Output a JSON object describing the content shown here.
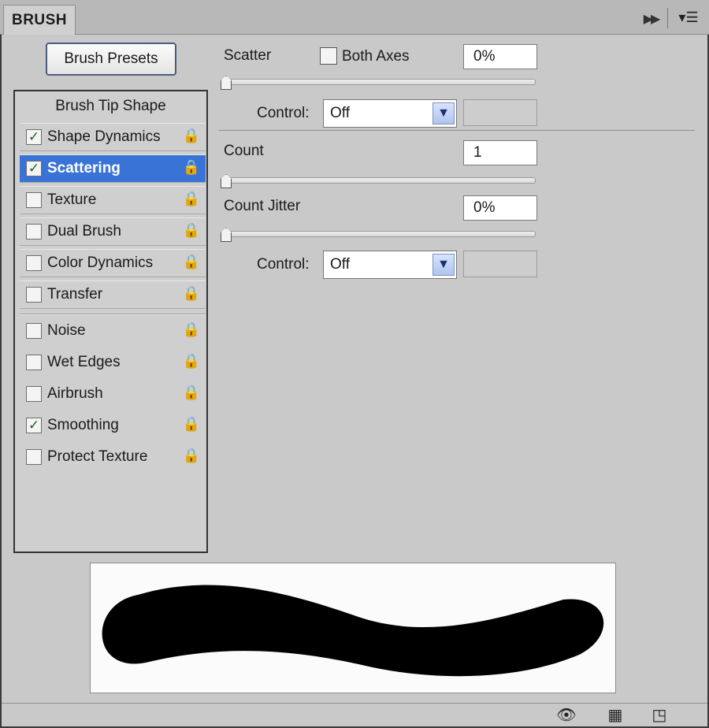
{
  "panel": {
    "tab_title": "BRUSH",
    "collapse_icon": "double-arrow-right",
    "menu_icon": "panel-menu"
  },
  "presets_button": "Brush Presets",
  "tip_list": {
    "header": "Brush Tip Shape",
    "options": [
      {
        "label": "Shape Dynamics",
        "checked": true,
        "check": "✓",
        "lock": "lock-icon"
      },
      {
        "label": "Scattering",
        "checked": true,
        "check": "✓",
        "active": true,
        "lock": "lock-icon"
      },
      {
        "label": "Texture",
        "checked": false,
        "check": "",
        "lock": "lock-icon"
      },
      {
        "label": "Dual Brush",
        "checked": false,
        "check": "",
        "lock": "lock-icon"
      },
      {
        "label": "Color Dynamics",
        "checked": false,
        "check": "",
        "lock": "lock-icon"
      },
      {
        "label": "Transfer",
        "checked": false,
        "check": "",
        "lock": "lock-icon"
      },
      {
        "label": "Noise",
        "checked": false,
        "check": "",
        "lock": "lock-icon"
      },
      {
        "label": "Wet Edges",
        "checked": false,
        "check": "",
        "lock": "lock-icon"
      },
      {
        "label": "Airbrush",
        "checked": false,
        "check": "",
        "lock": "lock-icon"
      },
      {
        "label": "Smoothing",
        "checked": true,
        "check": "✓",
        "lock": "lock-icon"
      },
      {
        "label": "Protect Texture",
        "checked": false,
        "check": "",
        "lock": "lock-icon"
      }
    ]
  },
  "settings": {
    "scatter": {
      "label": "Scatter",
      "value": "0%",
      "slider_value": 0,
      "both_axes_label": "Both Axes",
      "both_axes_checked": false
    },
    "control1": {
      "label": "Control:",
      "value": "Off"
    },
    "count": {
      "label": "Count",
      "value": "1",
      "slider_value": 0
    },
    "count_jitter": {
      "label": "Count Jitter",
      "value": "0%",
      "slider_value": 0
    },
    "control2": {
      "label": "Control:",
      "value": "Off"
    }
  },
  "footer": {
    "icons": [
      "eye-brush-icon",
      "grid-panel-icon",
      "new-preset-icon"
    ]
  }
}
